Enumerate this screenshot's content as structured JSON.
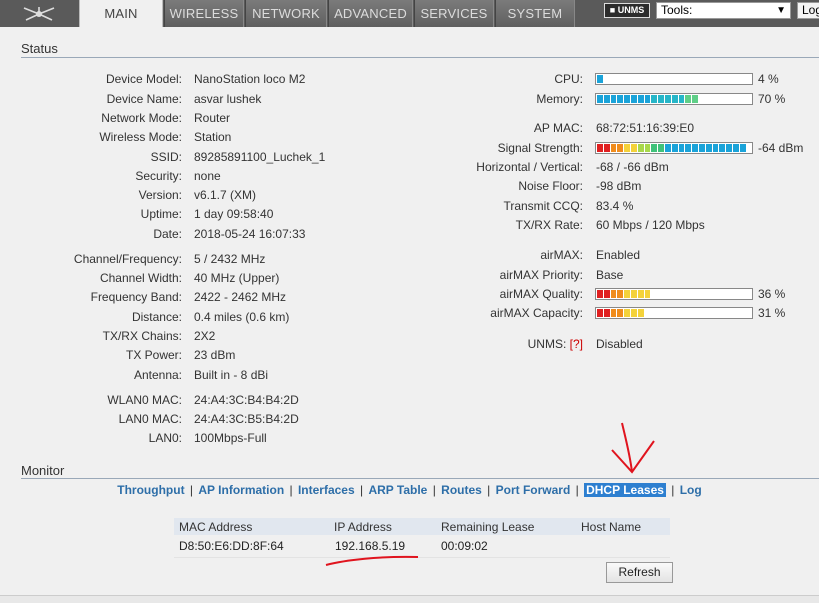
{
  "tabs": [
    "MAIN",
    "WIRELESS",
    "NETWORK",
    "ADVANCED",
    "SERVICES",
    "SYSTEM"
  ],
  "header": {
    "unms_logo": "UNMS",
    "tools_value": "Tools:",
    "logout_label": "Log"
  },
  "status": {
    "title": "Status",
    "left": [
      {
        "label": "Device Model:",
        "value": "NanoStation loco M2"
      },
      {
        "label": "Device Name:",
        "value": "asvar lushek"
      },
      {
        "label": "Network Mode:",
        "value": "Router"
      },
      {
        "label": "Wireless Mode:",
        "value": "Station"
      },
      {
        "label": "SSID:",
        "value": "89285891100_Luchek_1"
      },
      {
        "label": "Security:",
        "value": "none"
      },
      {
        "label": "Version:",
        "value": "v6.1.7 (XM)"
      },
      {
        "label": "Uptime:",
        "value": "1 day 09:58:40"
      },
      {
        "label": "Date:",
        "value": "2018-05-24 16:07:33"
      },
      {
        "label": "Channel/Frequency:",
        "value": "5 / 2432 MHz"
      },
      {
        "label": "Channel Width:",
        "value": "40 MHz (Upper)"
      },
      {
        "label": "Frequency Band:",
        "value": "2422 - 2462 MHz"
      },
      {
        "label": "Distance:",
        "value": "0.4 miles (0.6 km)"
      },
      {
        "label": "TX/RX Chains:",
        "value": "2X2"
      },
      {
        "label": "TX Power:",
        "value": "23 dBm"
      },
      {
        "label": "Antenna:",
        "value": "Built in - 8 dBi"
      },
      {
        "label": "WLAN0 MAC:",
        "value": "24:A4:3C:B4:B4:2D"
      },
      {
        "label": "LAN0 MAC:",
        "value": "24:A4:3C:B5:B4:2D"
      },
      {
        "label": "LAN0:",
        "value": "100Mbps-Full"
      }
    ],
    "cpu": {
      "label": "CPU:",
      "value": "4 %",
      "fraction": 0.04
    },
    "memory": {
      "label": "Memory:",
      "value": "70 %",
      "fraction": 0.7
    },
    "right": [
      {
        "label": "AP MAC:",
        "value": "68:72:51:16:39:E0"
      },
      {
        "label": "Signal Strength:",
        "value": "-64 dBm"
      },
      {
        "label": "Horizontal / Vertical:",
        "value": "-68 / -66 dBm"
      },
      {
        "label": "Noise Floor:",
        "value": "-98 dBm"
      },
      {
        "label": "Transmit CCQ:",
        "value": "83.4 %"
      },
      {
        "label": "TX/RX Rate:",
        "value": "60 Mbps / 120 Mbps"
      },
      {
        "label": "airMAX:",
        "value": "Enabled"
      },
      {
        "label": "airMAX Priority:",
        "value": "Base"
      }
    ],
    "signal_fraction": 1.0,
    "airmax_quality": {
      "label": "airMAX Quality:",
      "value": "36 %",
      "fraction": 0.36
    },
    "airmax_capacity": {
      "label": "airMAX Capacity:",
      "value": "31 %",
      "fraction": 0.31
    },
    "unms": {
      "label": "UNMS:",
      "help": "[?]",
      "value": "Disabled"
    }
  },
  "monitor": {
    "title": "Monitor",
    "links": [
      "Throughput",
      "AP Information",
      "Interfaces",
      "ARP Table",
      "Routes",
      "Port Forward",
      "DHCP Leases",
      "Log"
    ],
    "active_link": "DHCP Leases"
  },
  "dhcp": {
    "columns": [
      "MAC Address",
      "IP Address",
      "Remaining Lease",
      "Host Name"
    ],
    "rows": [
      [
        "D8:50:E6:DD:8F:64",
        "192.168.5.19",
        "00:09:02",
        ""
      ]
    ],
    "refresh_label": "Refresh"
  },
  "colors": {
    "tab_bar": "#5a5a5a",
    "link": "#2d6ea8",
    "active_link_bg": "#2d7fd0",
    "annotation": "#e0141e"
  }
}
